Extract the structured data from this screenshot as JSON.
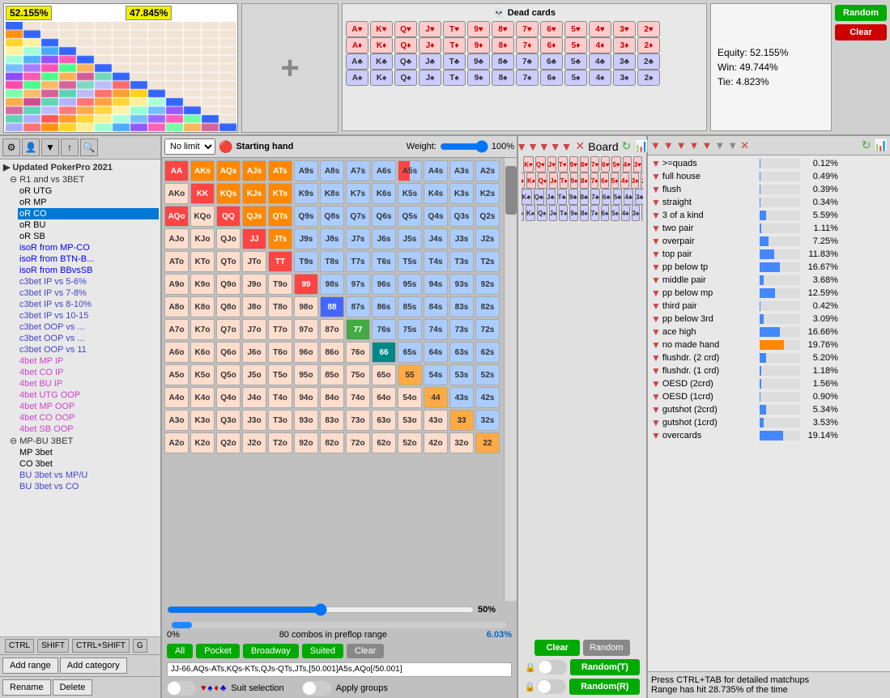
{
  "top": {
    "equity1": "52.155%",
    "equity2": "47.845%",
    "random_btn": "Random",
    "clear_btn": "Clear",
    "dead_cards_title": "Dead cards",
    "equity": {
      "equity": "Equity: 52.155%",
      "win": "Win: 49.744%",
      "tie": "Tie: 4.823%"
    },
    "cards": {
      "suits": [
        "h",
        "d",
        "c",
        "s"
      ],
      "ranks": [
        "A",
        "K",
        "Q",
        "J",
        "T",
        "9",
        "8",
        "7",
        "6",
        "5",
        "4",
        "3",
        "2"
      ]
    }
  },
  "range": {
    "mode": "No limit",
    "starting_hand_label": "Starting hand",
    "weight_label": "Weight:",
    "weight_value": "100%",
    "board_label": "Board",
    "range_pct": "50%",
    "bottom_pct": "0%",
    "combos_label": "80 combos in preflop range",
    "range_text": "JJ-66,AQs-ATs,KQs-KTs,QJs-QTs,JTs,[50.001]A5s,AQo[/50.001]",
    "all_btn": "All",
    "pocket_btn": "Pocket",
    "broadway_btn": "Broadway",
    "suited_btn": "Suited",
    "clear_btn": "Clear",
    "suit_label": "Suit selection",
    "apply_groups_label": "Apply groups"
  },
  "sidebar": {
    "root": "Updated PokerPro 2021",
    "items": [
      {
        "label": "R1 and vs 3BET",
        "level": 1
      },
      {
        "label": "oR UTG",
        "level": 2
      },
      {
        "label": "oR MP",
        "level": 2
      },
      {
        "label": "oR CO",
        "level": 2,
        "selected": true
      },
      {
        "label": "oR BU",
        "level": 2
      },
      {
        "label": "oR SB",
        "level": 2
      },
      {
        "label": "isoR from MP-CO",
        "level": 2,
        "colored": true
      },
      {
        "label": "isoR from BTN-B",
        "level": 2,
        "colored": true
      },
      {
        "label": "isoR from BBvsSB",
        "level": 2,
        "colored": true
      },
      {
        "label": "c3bet IP vs 5-6%",
        "level": 2,
        "colored": "blue"
      },
      {
        "label": "c3bet IP vs 7-8%",
        "level": 2,
        "colored": "blue"
      },
      {
        "label": "c3bet IP vs 8-10%",
        "level": 2,
        "colored": "blue"
      },
      {
        "label": "c3bet IP vs 10-15",
        "level": 2,
        "colored": "blue"
      },
      {
        "label": "c3bet OOP vs ...",
        "level": 2,
        "colored": "blue"
      },
      {
        "label": "c3bet OOP vs ...",
        "level": 2,
        "colored": "blue"
      },
      {
        "label": "c3bet OOP vs 11",
        "level": 2,
        "colored": "blue"
      },
      {
        "label": "4bet MP IP",
        "level": 2,
        "colored": "pink"
      },
      {
        "label": "4bet CO IP",
        "level": 2,
        "colored": "pink"
      },
      {
        "label": "4bet BU IP",
        "level": 2,
        "colored": "pink"
      },
      {
        "label": "4bet UTG OOP",
        "level": 2,
        "colored": "pink"
      },
      {
        "label": "4bet MP OOP",
        "level": 2,
        "colored": "pink"
      },
      {
        "label": "4bet CO OOP",
        "level": 2,
        "colored": "pink"
      },
      {
        "label": "4bet SB OOP",
        "level": 2,
        "colored": "pink"
      },
      {
        "label": "MP-BU 3BET",
        "level": 1
      },
      {
        "label": "MP 3bet",
        "level": 2
      },
      {
        "label": "CO 3bet",
        "level": 2
      },
      {
        "label": "BU 3bet vs MP/U",
        "level": 2,
        "colored": "blue"
      },
      {
        "label": "BU 3bet vs CO",
        "level": 2,
        "colored": "blue"
      }
    ],
    "keys": [
      "CTRL",
      "SHIFT",
      "CTRL+SHIFT",
      "G"
    ],
    "btns": [
      "Add range",
      "Add category",
      "Rename",
      "Delete"
    ]
  },
  "stats": {
    "items": [
      {
        "name": ">=quads",
        "value": "0.12%",
        "pct": 0.12,
        "color": "blue"
      },
      {
        "name": "full house",
        "value": "0.49%",
        "pct": 0.49,
        "color": "blue"
      },
      {
        "name": "flush",
        "value": "0.39%",
        "pct": 0.39,
        "color": "blue"
      },
      {
        "name": "straight",
        "value": "0.34%",
        "pct": 0.34,
        "color": "blue"
      },
      {
        "name": "3 of a kind",
        "value": "5.59%",
        "pct": 5.59,
        "color": "blue"
      },
      {
        "name": "two pair",
        "value": "1.11%",
        "pct": 1.11,
        "color": "blue"
      },
      {
        "name": "overpair",
        "value": "7.25%",
        "pct": 7.25,
        "color": "blue"
      },
      {
        "name": "top pair",
        "value": "11.83%",
        "pct": 11.83,
        "color": "blue"
      },
      {
        "name": "pp below tp",
        "value": "16.67%",
        "pct": 16.67,
        "color": "blue"
      },
      {
        "name": "middle pair",
        "value": "3.68%",
        "pct": 3.68,
        "color": "blue"
      },
      {
        "name": "pp below mp",
        "value": "12.59%",
        "pct": 12.59,
        "color": "blue"
      },
      {
        "name": "third pair",
        "value": "0.42%",
        "pct": 0.42,
        "color": "blue"
      },
      {
        "name": "pp below 3rd",
        "value": "3.09%",
        "pct": 3.09,
        "color": "blue"
      },
      {
        "name": "ace high",
        "value": "16.66%",
        "pct": 16.66,
        "color": "blue"
      },
      {
        "name": "no made hand",
        "value": "19.76%",
        "pct": 19.76,
        "color": "orange"
      },
      {
        "name": "flushdr. (2 crd)",
        "value": "5.20%",
        "pct": 5.2,
        "color": "blue"
      },
      {
        "name": "flushdr. (1 crd)",
        "value": "1.18%",
        "pct": 1.18,
        "color": "blue"
      },
      {
        "name": "OESD (2crd)",
        "value": "1.56%",
        "pct": 1.56,
        "color": "blue"
      },
      {
        "name": "OESD (1crd)",
        "value": "0.90%",
        "pct": 0.9,
        "color": "blue"
      },
      {
        "name": "gutshot (2crd)",
        "value": "5.34%",
        "pct": 5.34,
        "color": "blue"
      },
      {
        "name": "gutshot (1crd)",
        "value": "3.53%",
        "pct": 3.53,
        "color": "blue"
      },
      {
        "name": "overcards",
        "value": "19.14%",
        "pct": 19.14,
        "color": "blue"
      }
    ],
    "footer1": "Press CTRL+TAB for detailed matchups",
    "footer2": "Range has hit 28.735% of the time"
  },
  "board": {
    "clear_btn": "Clear",
    "random_btn": "Random",
    "random_t_btn": "Random(T)",
    "random_r_btn": "Random(R)"
  },
  "hand_grid": {
    "rows": [
      [
        "AA",
        "AKs",
        "AQs",
        "AJs",
        "ATs",
        "A9s",
        "A8s",
        "A7s",
        "A6s",
        "A5s",
        "A4s",
        "A3s",
        "A2s"
      ],
      [
        "AKo",
        "KK",
        "KQs",
        "KJs",
        "KTs",
        "K9s",
        "K8s",
        "K7s",
        "K6s",
        "K5s",
        "K4s",
        "K3s",
        "K2s"
      ],
      [
        "AQo",
        "KQo",
        "QQ",
        "QJs",
        "QTs",
        "Q9s",
        "Q8s",
        "Q7s",
        "Q6s",
        "Q5s",
        "Q4s",
        "Q3s",
        "Q2s"
      ],
      [
        "AJo",
        "KJo",
        "QJo",
        "JJ",
        "JTs",
        "J9s",
        "J8s",
        "J7s",
        "J6s",
        "J5s",
        "J4s",
        "J3s",
        "J2s"
      ],
      [
        "ATo",
        "KTo",
        "QTo",
        "JTo",
        "TT",
        "T9s",
        "T8s",
        "T7s",
        "T6s",
        "T5s",
        "T4s",
        "T3s",
        "T2s"
      ],
      [
        "A9o",
        "K9o",
        "Q9o",
        "J9o",
        "T9o",
        "99",
        "98s",
        "97s",
        "96s",
        "95s",
        "94s",
        "93s",
        "92s"
      ],
      [
        "A8o",
        "K8o",
        "Q8o",
        "J8o",
        "T8o",
        "98o",
        "88",
        "87s",
        "86s",
        "85s",
        "84s",
        "83s",
        "82s"
      ],
      [
        "A7o",
        "K7o",
        "Q7o",
        "J7o",
        "T7o",
        "97o",
        "87o",
        "77",
        "76s",
        "75s",
        "74s",
        "73s",
        "72s"
      ],
      [
        "A6o",
        "K6o",
        "Q6o",
        "J6o",
        "T6o",
        "96o",
        "86o",
        "76o",
        "66",
        "65s",
        "64s",
        "63s",
        "62s"
      ],
      [
        "A5o",
        "K5o",
        "Q5o",
        "J5o",
        "T5o",
        "95o",
        "85o",
        "75o",
        "65o",
        "55",
        "54s",
        "53s",
        "52s"
      ],
      [
        "A4o",
        "K4o",
        "Q4o",
        "J4o",
        "T4o",
        "94o",
        "84o",
        "74o",
        "64o",
        "54o",
        "44",
        "43s",
        "42s"
      ],
      [
        "A3o",
        "K3o",
        "Q3o",
        "J3o",
        "T3o",
        "93o",
        "83o",
        "73o",
        "63o",
        "53o",
        "43o",
        "33",
        "32s"
      ],
      [
        "A2o",
        "K2o",
        "Q2o",
        "J2o",
        "T2o",
        "92o",
        "82o",
        "72o",
        "62o",
        "52o",
        "42o",
        "32o",
        "22"
      ]
    ],
    "colors": {
      "AA": "red-full",
      "KK": "red-full",
      "QQ": "red-full",
      "JJ": "red-full",
      "TT": "red-full",
      "99": "red-full",
      "88": "blue-full",
      "77": "green-full",
      "66": "teal-full",
      "55": "grey",
      "44": "grey",
      "33": "grey",
      "22": "grey",
      "AKs": "orange",
      "AQs": "orange",
      "AJs": "orange",
      "ATs": "orange",
      "KQs": "orange",
      "KJs": "orange",
      "KTs": "orange",
      "QJs": "orange",
      "QTs": "orange",
      "JTs": "orange",
      "A5s": "half-red",
      "AQo": "red-full",
      "AKo": "grey"
    }
  }
}
